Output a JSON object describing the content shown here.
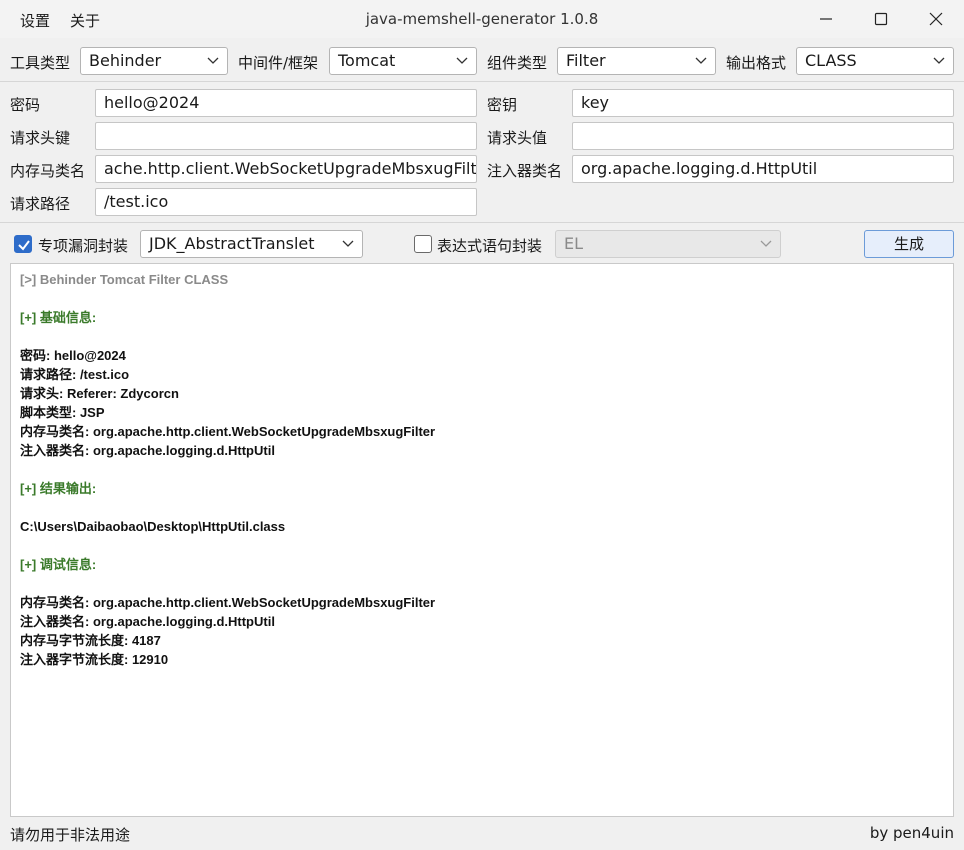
{
  "window": {
    "title": "java-memshell-generator 1.0.8",
    "menu": [
      "设置",
      "关于"
    ]
  },
  "config": {
    "tool_type": {
      "label": "工具类型",
      "value": "Behinder"
    },
    "middleware": {
      "label": "中间件/框架",
      "value": "Tomcat"
    },
    "component": {
      "label": "组件类型",
      "value": "Filter"
    },
    "output_format": {
      "label": "输出格式",
      "value": "CLASS"
    }
  },
  "fields": {
    "password": {
      "label": "密码",
      "value": "hello@2024"
    },
    "key": {
      "label": "密钥",
      "value": "key"
    },
    "header_key": {
      "label": "请求头键",
      "value": ""
    },
    "header_value": {
      "label": "请求头值",
      "value": ""
    },
    "shell_class": {
      "label": "内存马类名",
      "value": "ache.http.client.WebSocketUpgradeMbsxugFilter"
    },
    "injector_class": {
      "label": "注入器类名",
      "value": "org.apache.logging.d.HttpUtil"
    },
    "request_path": {
      "label": "请求路径",
      "value": "/test.ico"
    }
  },
  "options": {
    "vuln_wrap": {
      "label": "专项漏洞封装",
      "checked": true,
      "value": "JDK_AbstractTranslet"
    },
    "expr_wrap": {
      "label": "表达式语句封装",
      "checked": false,
      "value": "EL"
    },
    "generate_label": "生成"
  },
  "output": {
    "lines": [
      {
        "style": "head",
        "text": "[>] Behinder Tomcat Filter CLASS"
      },
      {
        "style": "blank",
        "text": ""
      },
      {
        "style": "section",
        "text": "[+] 基础信息:"
      },
      {
        "style": "blank",
        "text": ""
      },
      {
        "style": "text",
        "text": "密码: hello@2024"
      },
      {
        "style": "text",
        "text": "请求路径: /test.ico"
      },
      {
        "style": "text",
        "text": "请求头: Referer: Zdycorcn"
      },
      {
        "style": "text",
        "text": "脚本类型: JSP"
      },
      {
        "style": "text",
        "text": "内存马类名: org.apache.http.client.WebSocketUpgradeMbsxugFilter"
      },
      {
        "style": "text",
        "text": "注入器类名: org.apache.logging.d.HttpUtil"
      },
      {
        "style": "blank",
        "text": ""
      },
      {
        "style": "section",
        "text": "[+] 结果输出:"
      },
      {
        "style": "blank",
        "text": ""
      },
      {
        "style": "text",
        "text": "C:\\Users\\Daibaobao\\Desktop\\HttpUtil.class"
      },
      {
        "style": "blank",
        "text": ""
      },
      {
        "style": "section",
        "text": "[+] 调试信息:"
      },
      {
        "style": "blank",
        "text": ""
      },
      {
        "style": "text",
        "text": "内存马类名: org.apache.http.client.WebSocketUpgradeMbsxugFilter"
      },
      {
        "style": "text",
        "text": "注入器类名: org.apache.logging.d.HttpUtil"
      },
      {
        "style": "text",
        "text": "内存马字节流长度: 4187"
      },
      {
        "style": "text",
        "text": "注入器字节流长度: 12910"
      }
    ]
  },
  "status": {
    "left": "请勿用于非法用途",
    "right": "by pen4uin"
  },
  "colors": {
    "section": "#3a7a2a",
    "head": "#8a8a8a",
    "accent": "#2e6cc9"
  }
}
